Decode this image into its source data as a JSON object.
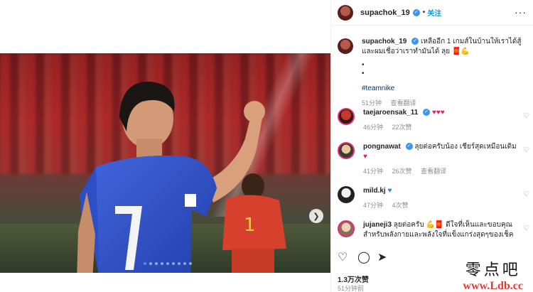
{
  "post": {
    "author": "supachok_19",
    "header_separator": "•",
    "follow_label": "关注",
    "more_icon": "more-horizontal-icon",
    "caption_line1": "เหลืออีก 1 เกมส์ในบ้านให้เราได้สู้",
    "caption_line2": "และผมเชื่อว่าเราทำมันได้ ลุย",
    "caption_emojis": "🧧💪",
    "bullet1": "•",
    "bullet2": "•",
    "hashtag": "#teamnike",
    "time": "51分钟",
    "translate": "查看翻译",
    "likes": "1.3万次赞",
    "posted": "51分钟前",
    "carousel_dots": 9,
    "active_dot": 0
  },
  "comments": [
    {
      "user": "taejaroensak_11",
      "verified": true,
      "text": "♥♥♥",
      "time": "46分钟",
      "likes": "22次赞",
      "translate": ""
    },
    {
      "user": "pongnawat",
      "verified": true,
      "text": "ลุยต่อครับน้อง เชียร์สุดเหมือนเดิม",
      "text2": "♥",
      "time": "41分钟",
      "likes": "26次赞",
      "translate": "查看翻译"
    },
    {
      "user": "mild.kj",
      "verified": false,
      "text": "♥",
      "time": "47分钟",
      "likes": "4次赞",
      "translate": ""
    },
    {
      "user": "jujaneji3",
      "verified": false,
      "text": "ลุยต่อครับ 💪🧧 ดีใจที่เห็นและขอบคุณ",
      "text2": "สำหรับพลังกายและพลังใจที่แข็งแกร่งสุดๆของเช็ค",
      "time": "",
      "likes": "",
      "translate": ""
    }
  ],
  "watermark": {
    "cn": "零点吧",
    "url": "www.Ldb.cc"
  },
  "colors": {
    "link": "#0095f6",
    "hashtag": "#00376b",
    "muted": "#8e8e8e",
    "heart": "#e0245e"
  }
}
